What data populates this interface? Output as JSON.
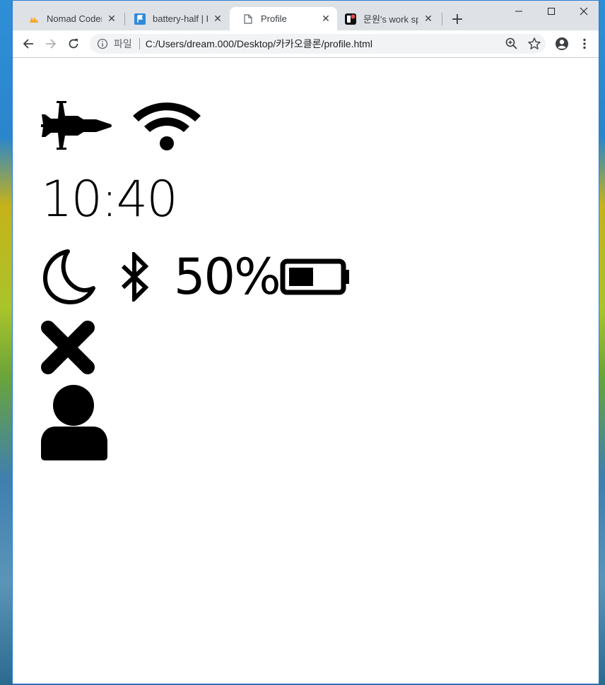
{
  "browser": {
    "tabs": [
      {
        "title": "Nomad Coders",
        "icon": "nomad-coders-favicon"
      },
      {
        "title": "battery-half | Fo",
        "icon": "flag-favicon"
      },
      {
        "title": "Profile",
        "icon": "file-icon"
      },
      {
        "title": "문원's work spa",
        "icon": "work-space-favicon"
      }
    ],
    "new_tab_label": "+",
    "omnibox": {
      "scheme": "파일",
      "url": "C:/Users/dream.000/Desktop/카카오클론/profile.html"
    }
  },
  "page": {
    "time": "10:40",
    "battery_percent": "50%",
    "battery_level": 0.5,
    "icons": [
      "airplane-icon",
      "wifi-icon",
      "moon-icon",
      "bluetooth-icon",
      "battery-half-icon",
      "close-x-icon",
      "user-icon"
    ]
  },
  "colors": {
    "tabstrip": "#dee1e6",
    "window_border": "#2b7bd5",
    "icon": "#000000"
  }
}
